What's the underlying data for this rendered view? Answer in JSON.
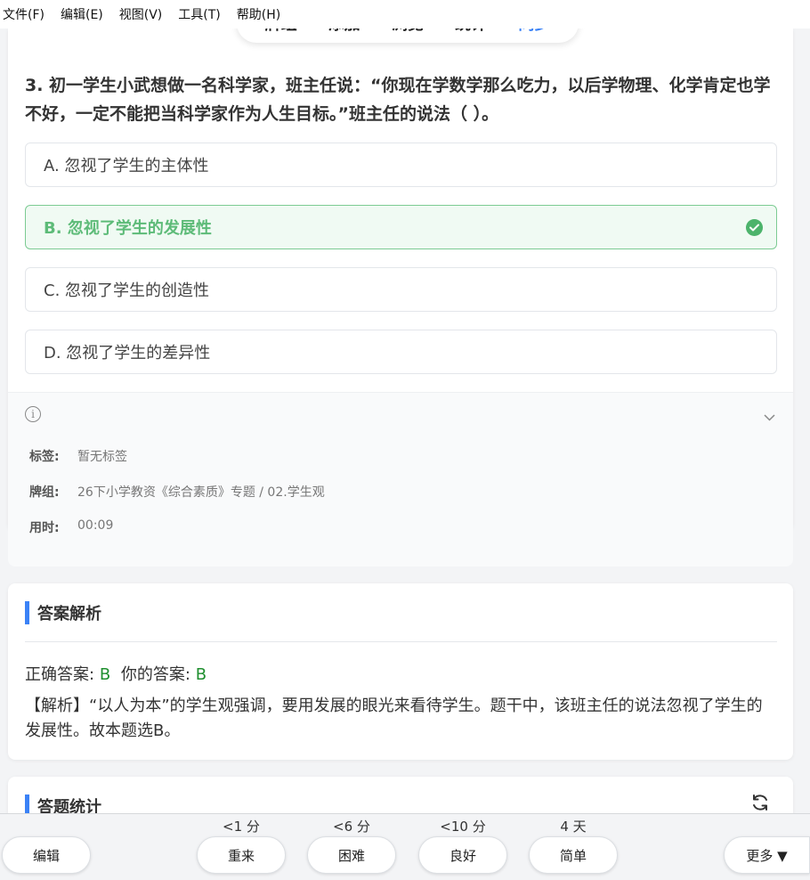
{
  "menu": [
    "文件(F)",
    "编辑(E)",
    "视图(V)",
    "工具(T)",
    "帮助(H)"
  ],
  "nav": {
    "items": [
      "牌组",
      "添加",
      "浏览",
      "统计",
      "同步"
    ],
    "active_index": 4
  },
  "question": {
    "text": "3. 初一学生小武想做一名科学家，班主任说：“你现在学数学那么吃力，以后学物理、化学肯定也学不好，一定不能把当科学家作为人生目标。”班主任的说法（ ）。",
    "options": [
      {
        "label": "A. 忽视了学生的主体性",
        "correct": false
      },
      {
        "label": "B. 忽视了学生的发展性",
        "correct": true
      },
      {
        "label": "C. 忽视了学生的创造性",
        "correct": false
      },
      {
        "label": "D. 忽视了学生的差异性",
        "correct": false
      }
    ]
  },
  "info": {
    "tags_key": "标签:",
    "tags_val": "暂无标签",
    "deck_key": "牌组:",
    "deck_val": "26下小学教资《综合素质》专题 / 02.学生观",
    "time_key": "用时:",
    "time_val": "00:09"
  },
  "analysis": {
    "title": "答案解析",
    "correct_label": "正确答案:",
    "correct_value": "B",
    "yours_label": "你的答案:",
    "yours_value": "B",
    "explanation": "【解析】“以人为本”的学生观强调，要用发展的眼光来看待学生。题干中，该班主任的说法忽视了学生的发展性。故本题选B。"
  },
  "stats": {
    "title": "答题统计"
  },
  "bottom": {
    "edit": "编辑",
    "intervals": [
      "<1 分",
      "<6 分",
      "<10 分",
      "4 天"
    ],
    "buttons": [
      "重来",
      "困难",
      "良好",
      "简单"
    ],
    "more": "更多 ▼"
  },
  "colors": {
    "accent": "#3b82f6",
    "correct": "#4cb36b",
    "answer_text": "#1f8f2f"
  }
}
